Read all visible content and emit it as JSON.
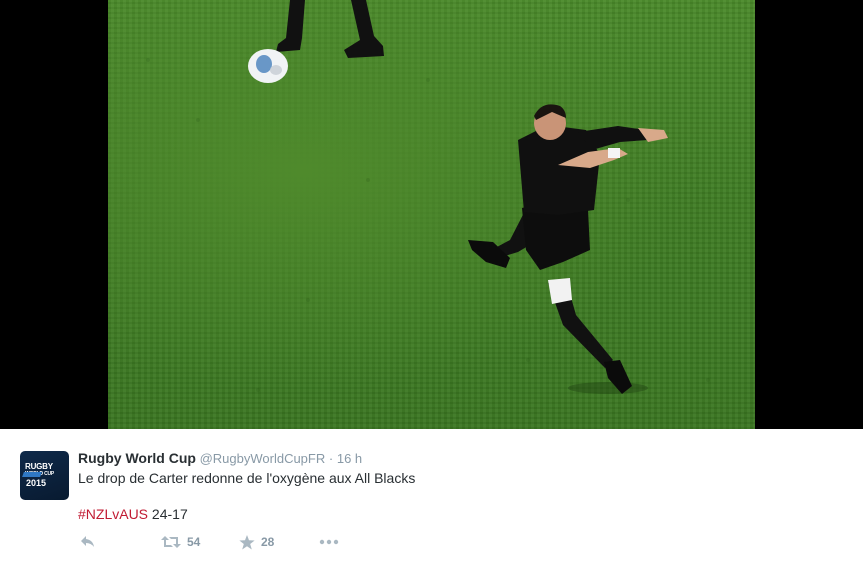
{
  "media": {
    "description_icon": "rugby-kick-photo"
  },
  "tweet": {
    "display_name": "Rugby World Cup",
    "handle": "@RugbyWorldCupFR",
    "separator": "·",
    "timestamp": "16 h",
    "text": "Le drop de Carter redonne de l'oxygène aux All Blacks",
    "hashtag": "#NZLvAUS",
    "score": " 24-17",
    "avatar": {
      "line1": "RUGBY",
      "line2": "WORLD CUP",
      "year": "2015"
    }
  },
  "actions": {
    "reply_icon": "reply-icon",
    "retweet_icon": "retweet-icon",
    "retweet_count": "54",
    "favorite_icon": "star-icon",
    "favorite_count": "28",
    "more_icon": "more-icon"
  },
  "colors": {
    "hashtag": "#c11b33",
    "muted": "#8899a6",
    "text": "#292f33",
    "grass": "#3f7d24"
  }
}
